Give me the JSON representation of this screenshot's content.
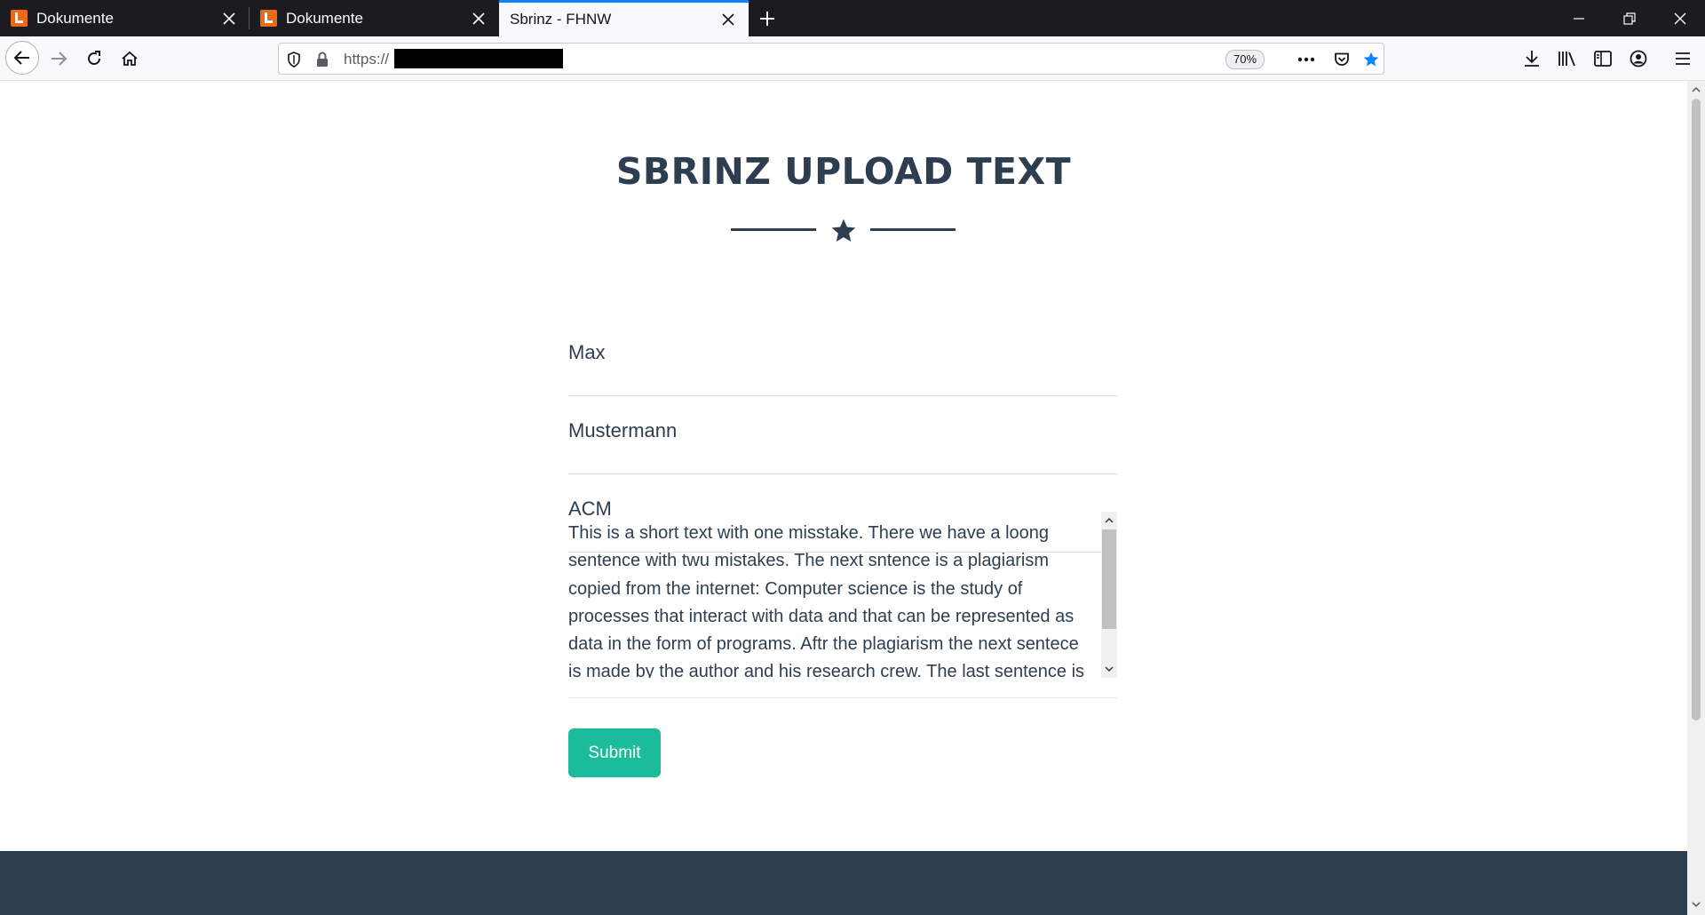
{
  "browser": {
    "tabs": [
      {
        "title": "Dokumente",
        "active": false,
        "favicon": "document-app-icon"
      },
      {
        "title": "Dokumente",
        "active": false,
        "favicon": "document-app-icon"
      },
      {
        "title": "Sbrinz - FHNW",
        "active": true
      }
    ],
    "url": "https://",
    "zoom": "70%",
    "accent_color": "#0a84ff"
  },
  "page": {
    "title": "SBRINZ UPLOAD TEXT",
    "fields": {
      "first_name": "Max",
      "last_name": "Mustermann",
      "organization": "ACM"
    },
    "text_content": "This is a short text with one misstake. There we have a loong sentence with twu mistakes. The next sntence is a plagiarism copied from the internet: Computer science is the study of processes that interact with data and that can be represented as data in the form of programs. Aftr the plagiarism the next sentece is made by the author and his research crew. The last sentence is a",
    "submit_label": "Submit",
    "colors": {
      "heading": "#2c3e50",
      "button": "#1abc9c",
      "footer": "#2c3e50"
    }
  }
}
